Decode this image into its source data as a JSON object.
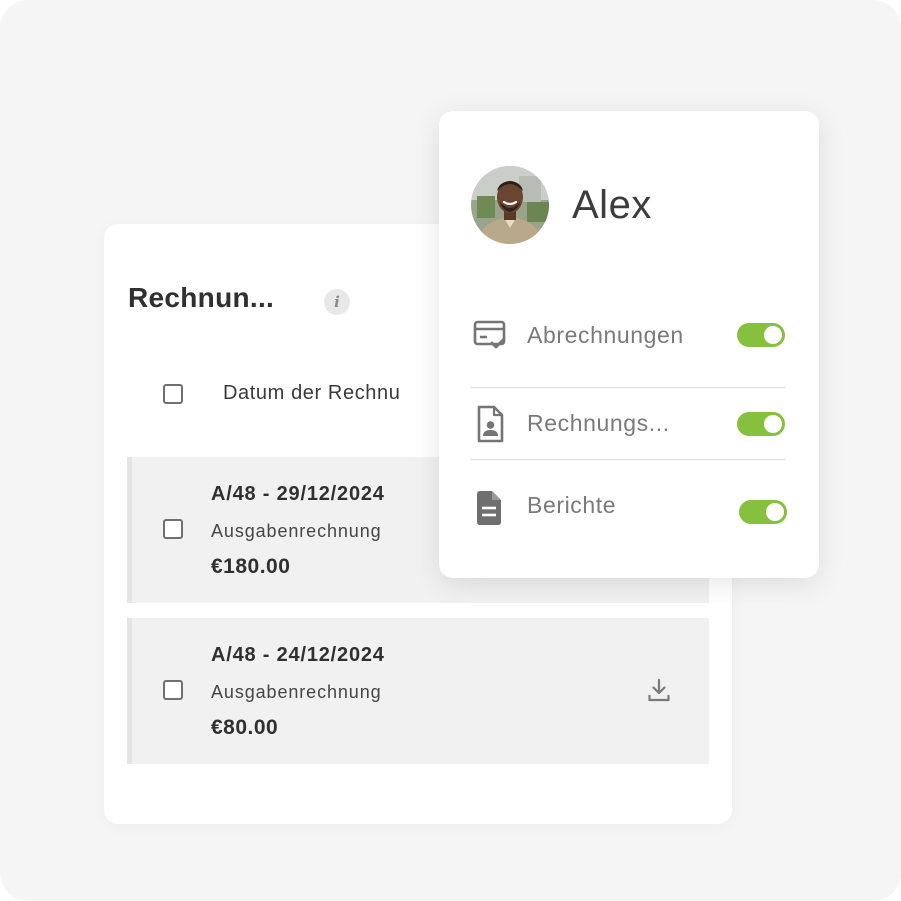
{
  "invoices": {
    "title": "Rechnun...",
    "info_icon": "i",
    "column_header": "Datum der Rechnu",
    "rows": [
      {
        "title": "A/48 - 29/12/2024",
        "type": "Ausgabenrechnung",
        "amount": "€180.00"
      },
      {
        "title": "A/48 - 24/12/2024",
        "type": "Ausgabenrechnung",
        "amount": "€80.00"
      }
    ]
  },
  "profile": {
    "name": "Alex",
    "permissions": [
      {
        "label": "Abrechnungen",
        "icon": "invoice-check-icon",
        "enabled": true
      },
      {
        "label": "Rechnungs...",
        "icon": "document-user-icon",
        "enabled": true
      },
      {
        "label": "Berichte",
        "icon": "document-icon",
        "enabled": true
      }
    ]
  },
  "colors": {
    "toggle_on": "#85c13d",
    "text_dark": "#303030",
    "text_muted": "#7a7a7a",
    "row_bg": "#f1f1f1"
  }
}
